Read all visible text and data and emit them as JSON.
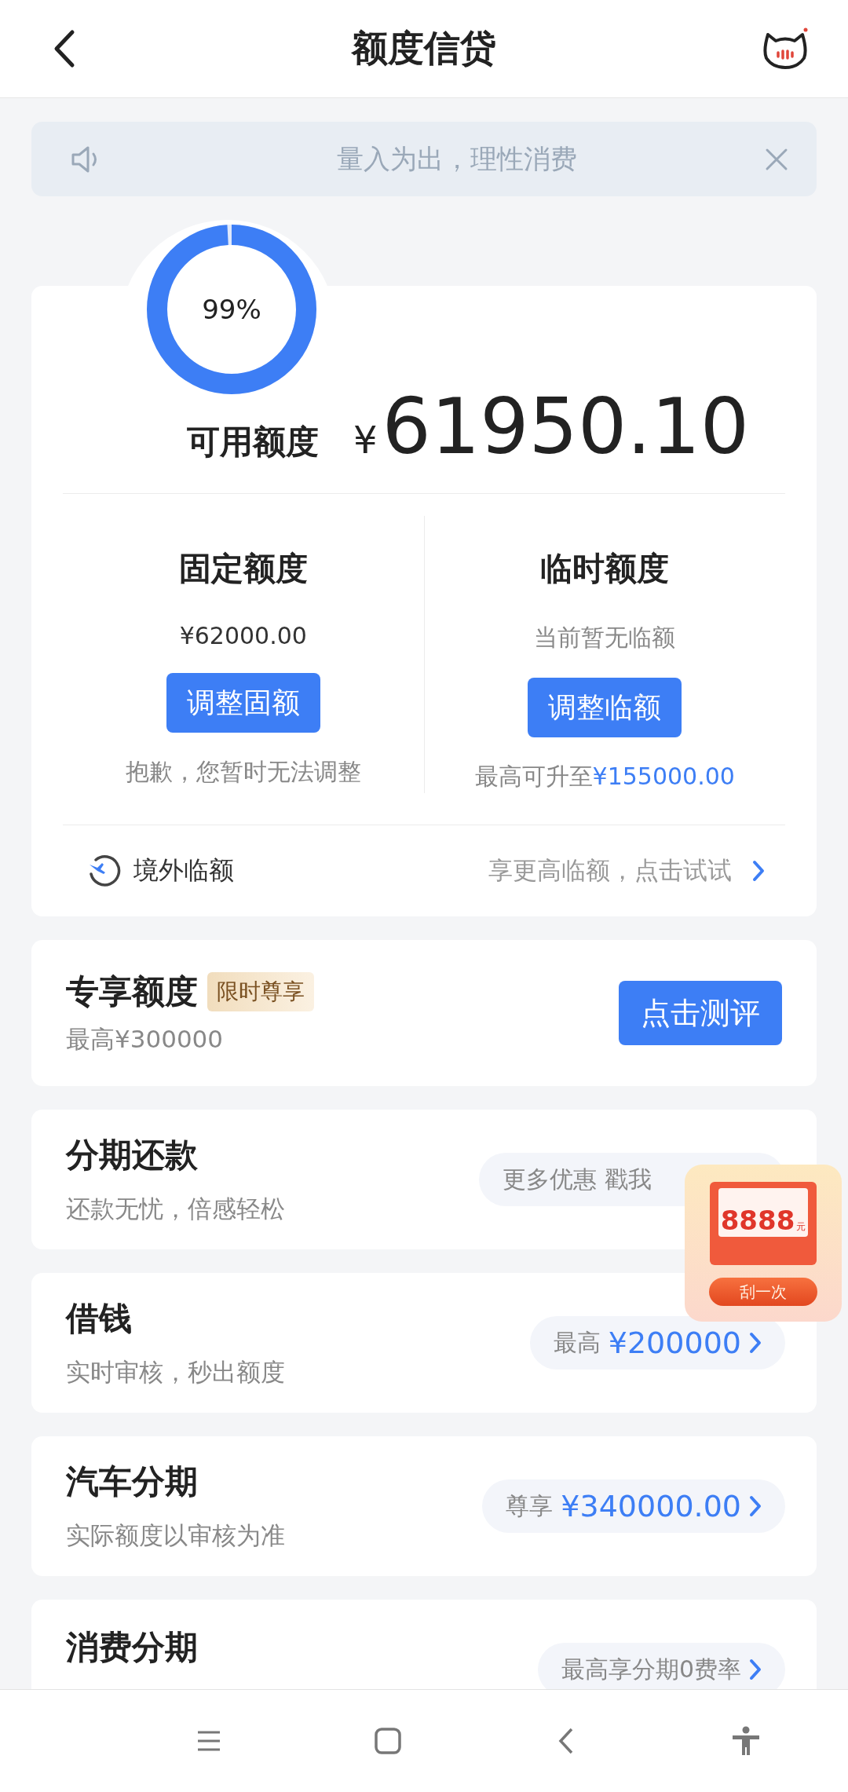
{
  "header": {
    "title": "额度信贷"
  },
  "notice": {
    "text": "量入为出，理性消费"
  },
  "credit": {
    "ring_label": "99%",
    "level": 0.99,
    "label": "可用额度",
    "currency": "¥",
    "amount": "61950.10"
  },
  "limits": [
    {
      "title": "固定额度",
      "value": "¥62000.00",
      "button": "调整固额",
      "note": "抱歉，您暂时无法调整"
    },
    {
      "title": "临时额度",
      "value": "当前暂无临额",
      "button": "调整临额",
      "note": "最高可升至",
      "note_highlight": "¥155000.00"
    }
  ],
  "overseas": {
    "label": "境外临额",
    "hint": "享更高临额，点击试试"
  },
  "exclusive": {
    "title": "专享额度",
    "tag": "限时尊享",
    "sub": "最高¥300000",
    "button": "点击测评"
  },
  "products": [
    {
      "title": "分期还款",
      "sub": "还款无忧，倍感轻松",
      "pill_text": "更多优惠 戳我",
      "arrow": false
    },
    {
      "title": "借钱",
      "sub": "实时审核，秒出额度",
      "pill_text": "最高",
      "pill_amount": "¥200000",
      "arrow": true
    },
    {
      "title": "汽车分期",
      "sub": "实际额度以审核为准",
      "pill_text": "尊享",
      "pill_amount": "¥340000.00",
      "arrow": true
    },
    {
      "title": "消费分期",
      "pill_text": "最高享分期0费率",
      "arrow": true
    }
  ],
  "promo": {
    "amount": "8888",
    "unit": "元",
    "button": "刮一次"
  }
}
